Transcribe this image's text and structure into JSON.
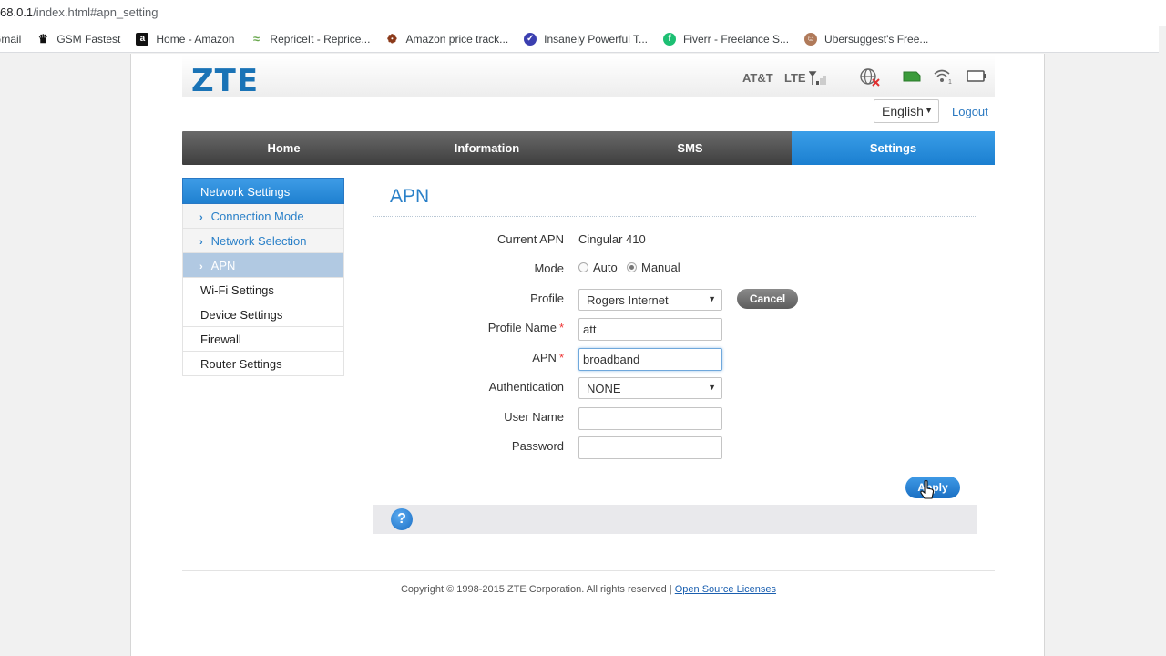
{
  "browser": {
    "url_prefix": "68.0.1",
    "url_path": "/index.html#apn_setting",
    "bookmarks": [
      {
        "label": "Gmail",
        "icon": "gmail-icon"
      },
      {
        "label": "GSM Fastest",
        "icon": "tool-icon"
      },
      {
        "label": "Home - Amazon",
        "icon": "amazon-icon"
      },
      {
        "label": "RepriceIt - Reprice...",
        "icon": "repriceit-icon"
      },
      {
        "label": "Amazon price track...",
        "icon": "camel-icon"
      },
      {
        "label": "Insanely Powerful T...",
        "icon": "check-icon"
      },
      {
        "label": "Fiverr - Freelance S...",
        "icon": "fiverr-icon"
      },
      {
        "label": "Ubersuggest's Free...",
        "icon": "avatar-icon"
      }
    ]
  },
  "header": {
    "logo": "ZTE",
    "carrier": "AT&T",
    "network": "LTE",
    "signal_level": 1
  },
  "lang": {
    "selected": "English",
    "logout": "Logout"
  },
  "nav": {
    "items": [
      "Home",
      "Information",
      "SMS",
      "Settings"
    ],
    "active": 3
  },
  "sidebar": {
    "section": "Network Settings",
    "subitems": [
      "Connection Mode",
      "Network Selection",
      "APN"
    ],
    "items": [
      "Wi-Fi Settings",
      "Device Settings",
      "Firewall",
      "Router Settings"
    ]
  },
  "main": {
    "title": "APN",
    "current_apn_label": "Current APN",
    "current_apn_value": "Cingular 410",
    "mode_label": "Mode",
    "mode_auto": "Auto",
    "mode_manual": "Manual",
    "profile_label": "Profile",
    "profile_value": "Rogers Internet",
    "cancel": "Cancel",
    "profile_name_label": "Profile Name",
    "profile_name_value": "att",
    "apn_label": "APN",
    "apn_value": "broadband",
    "auth_label": "Authentication",
    "auth_value": "NONE",
    "user_label": "User Name",
    "user_value": "",
    "password_label": "Password",
    "password_value": "",
    "apply": "Apply",
    "required_mark": "*",
    "help": "?"
  },
  "footer": {
    "copyright": "Copyright © 1998-2015 ZTE Corporation. All rights reserved  |",
    "link": "Open Source Licenses"
  }
}
